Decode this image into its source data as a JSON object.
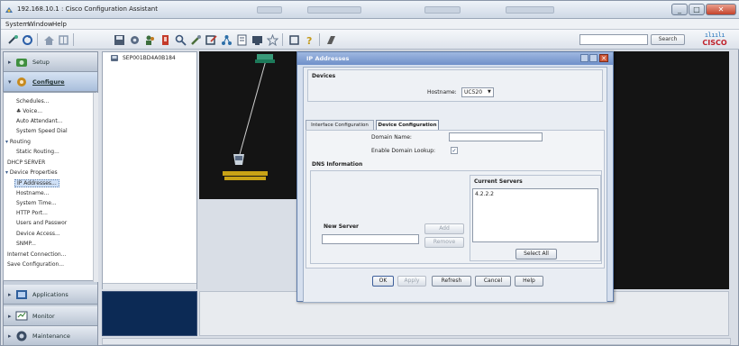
{
  "window": {
    "title": "192.168.10.1 : Cisco Configuration Assistant"
  },
  "menu": [
    "System",
    "Window",
    "Help"
  ],
  "search": {
    "placeholder": "",
    "button": "Search"
  },
  "brand": {
    "logo_bars": "ılıılı",
    "logo_word": "CISCO",
    "accent": "#1b6fb8",
    "logo_red": "#c0202a"
  },
  "nav": {
    "setup": "Setup",
    "configure": "Configure",
    "applications": "Applications",
    "monitor": "Monitor",
    "maintenance": "Maintenance",
    "tree": [
      "Schedules...",
      "Voice...",
      "Auto Attendant...",
      "System Speed Dial",
      "Routing",
      "Static Routing...",
      "DHCP SERVER",
      "Device Properties",
      "IP Addresses...",
      "Hostname...",
      "System Time...",
      "HTTP Port...",
      "Users and Passwor",
      "Device Access...",
      "SNMP...",
      "Internet Connection...",
      "Save Configuration..."
    ]
  },
  "device_list": {
    "item": "SEP001BD4A0B184"
  },
  "dialog": {
    "title": "IP Addresses",
    "devices_label": "Devices",
    "hostname_label": "Hostname:",
    "hostname_value": "UC520",
    "tabs": [
      "Interface Configuration",
      "Device Configuration"
    ],
    "active_tab": "Device Configuration",
    "domain_label": "Domain Name:",
    "domain_value": "",
    "lookup_label": "Enable Domain Lookup:",
    "lookup_checked": true,
    "dns_header": "DNS Information",
    "current_servers_header": "Current Servers",
    "servers": [
      "4.2.2.2"
    ],
    "new_server_label": "New Server",
    "new_server_value": "",
    "add": "Add",
    "remove": "Remove",
    "select_all": "Select All",
    "ok": "OK",
    "apply": "Apply",
    "refresh": "Refresh",
    "cancel": "Cancel",
    "help": "Help"
  }
}
